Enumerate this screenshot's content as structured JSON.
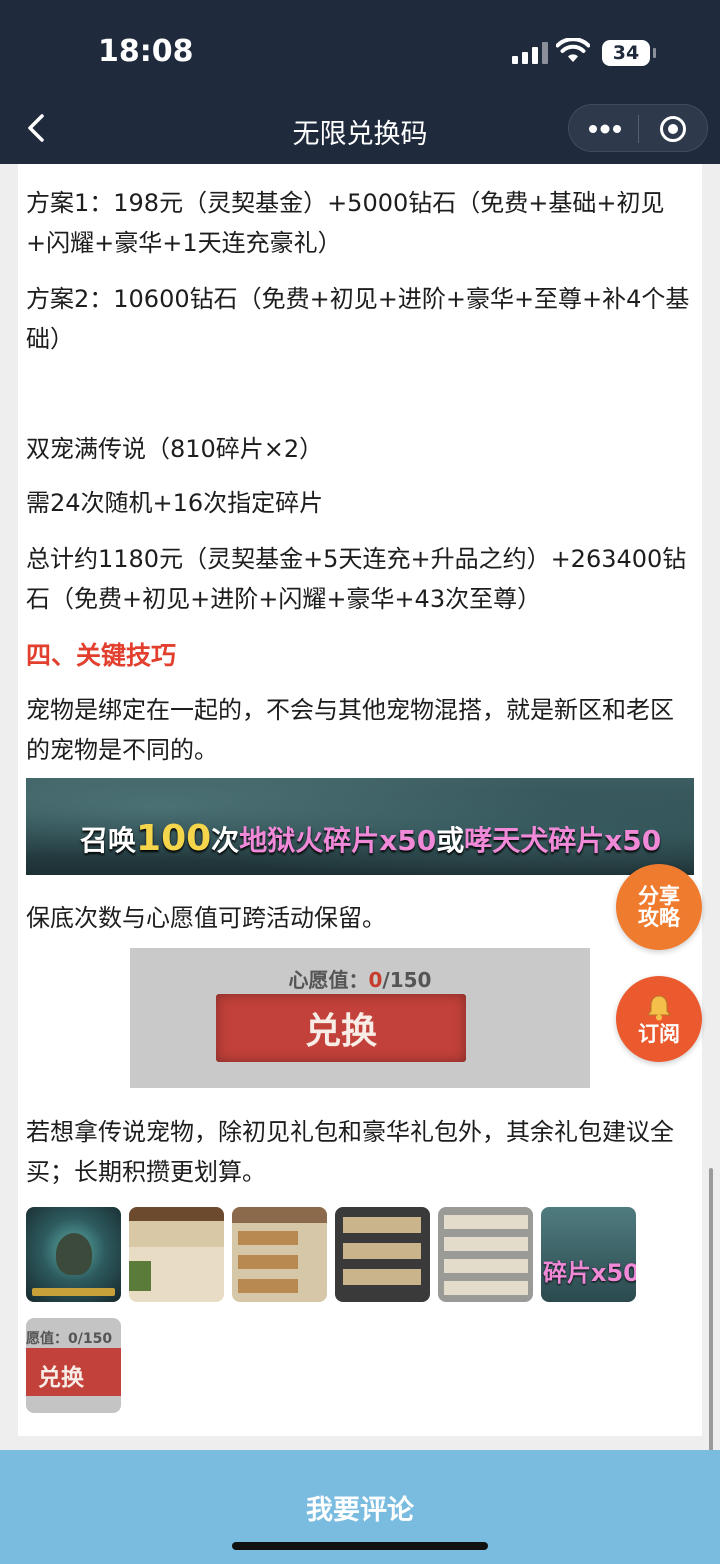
{
  "status_bar": {
    "time": "18:08",
    "battery": "34"
  },
  "nav": {
    "title": "无限兑换码"
  },
  "content": {
    "plan1": "方案1：198元（灵契基金）+5000钻石（免费+基础+初见+闪耀+豪华+1天连充豪礼）",
    "plan2": "方案2：10600钻石（免费+初见+进阶+豪华+至尊+补4个基础）",
    "double_pet": "双宠满传说（810碎片×2）",
    "need": "需24次随机+16次指定碎片",
    "total": "总计约1180元（灵契基金+5天连充+升品之约）+263400钻石（免费+初见+进阶+闪耀+豪华+43次至尊）",
    "section4": "四、关键技巧",
    "tip1": "宠物是绑定在一起的，不会与其他宠物混搭，就是新区和老区的宠物是不同的。",
    "banner": {
      "p1": "召唤",
      "num": "100",
      "p2": "次",
      "g1": "地狱火碎片x50",
      "or": "或",
      "g2": "哮天犬碎片x50"
    },
    "tip2": "保底次数与心愿值可跨活动保留。",
    "exchange": {
      "wish_label": "心愿值：",
      "wish_cur": "0",
      "wish_max": "/150",
      "button": "兑换"
    },
    "tip3": "若想拿传说宠物，除初见礼包和豪华礼包外，其余礼包建议全买；长期积攒更划算。",
    "thumbs": {
      "t6_caption": "碎片x50",
      "t7_wish": "愿值：0/150",
      "t7_button": "兑换"
    }
  },
  "fabs": {
    "share": "分享攻略",
    "subscribe": "订阅"
  },
  "comment": {
    "label": "我要评论"
  },
  "colors": {
    "header_bg": "#1f2b3d",
    "section_title": "#e23f2e",
    "fab_orange": "#ef7b2f",
    "comment_bar": "#79bce0"
  }
}
